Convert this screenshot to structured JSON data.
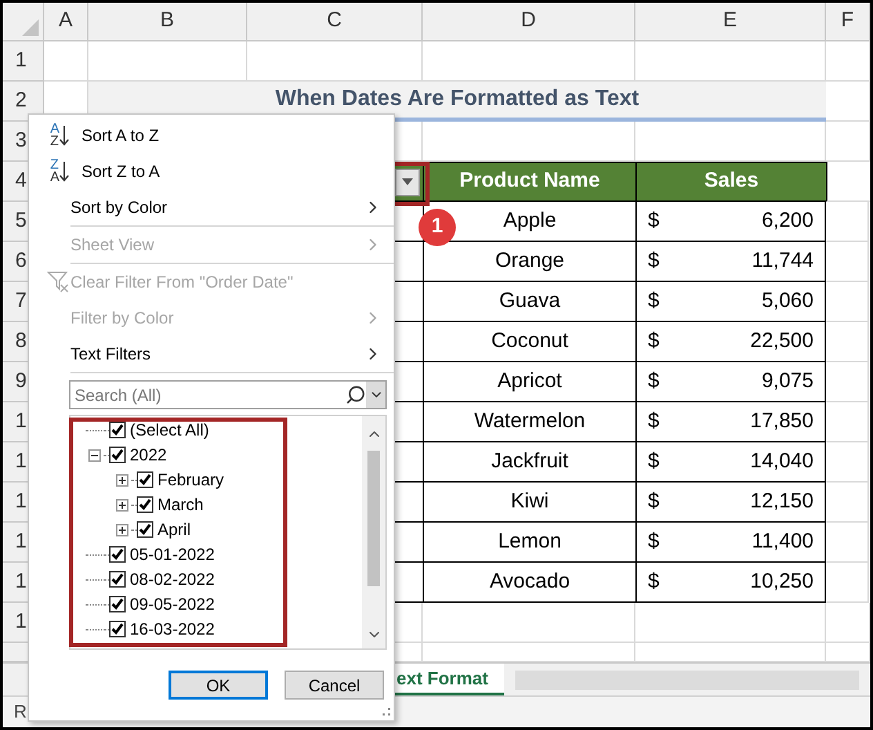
{
  "columns": [
    "A",
    "B",
    "C",
    "D",
    "E",
    "F"
  ],
  "row_numbers": [
    "1",
    "2",
    "3",
    "4",
    "5",
    "6",
    "7",
    "8",
    "9",
    "1",
    "1",
    "1",
    "1",
    "1",
    "1"
  ],
  "title": "When Dates Are Formatted as Text",
  "table": {
    "columns": [
      "Product Name",
      "Sales"
    ],
    "rows": [
      {
        "product": "Apple",
        "currency": "$",
        "sales": "6,200"
      },
      {
        "product": "Orange",
        "currency": "$",
        "sales": "11,744"
      },
      {
        "product": "Guava",
        "currency": "$",
        "sales": "5,060"
      },
      {
        "product": "Coconut",
        "currency": "$",
        "sales": "22,500"
      },
      {
        "product": "Apricot",
        "currency": "$",
        "sales": "9,075"
      },
      {
        "product": "Watermelon",
        "currency": "$",
        "sales": "17,850"
      },
      {
        "product": "Jackfruit",
        "currency": "$",
        "sales": "14,040"
      },
      {
        "product": "Kiwi",
        "currency": "$",
        "sales": "12,150"
      },
      {
        "product": "Lemon",
        "currency": "$",
        "sales": "11,400"
      },
      {
        "product": "Avocado",
        "currency": "$",
        "sales": "10,250"
      }
    ]
  },
  "step_badge": "1",
  "filter_menu": {
    "items": [
      {
        "kind": "sort",
        "label": "Sort A to Z",
        "icon_top": "A",
        "icon_bottom": "Z",
        "disabled": false,
        "submenu": false,
        "separator_after": false
      },
      {
        "kind": "sort",
        "label": "Sort Z to A",
        "icon_top": "Z",
        "icon_bottom": "A",
        "disabled": false,
        "submenu": false,
        "separator_after": false
      },
      {
        "kind": "plain",
        "label": "Sort by Color",
        "disabled": false,
        "submenu": true,
        "separator_after": true
      },
      {
        "kind": "plain",
        "label": "Sheet View",
        "disabled": true,
        "submenu": true,
        "separator_after": true
      },
      {
        "kind": "clear",
        "label": "Clear Filter From \"Order Date\"",
        "disabled": true,
        "submenu": false,
        "separator_after": false
      },
      {
        "kind": "plain",
        "label": "Filter by Color",
        "disabled": true,
        "submenu": true,
        "separator_after": false
      },
      {
        "kind": "plain",
        "label": "Text Filters",
        "disabled": false,
        "submenu": true,
        "separator_after": true
      }
    ],
    "search": {
      "placeholder": "Search (All)"
    },
    "tree": [
      {
        "label": "(Select All)",
        "checked": true
      },
      {
        "label": "2022",
        "checked": true,
        "expanded": true,
        "children": [
          {
            "label": "February",
            "checked": true,
            "expanded": false
          },
          {
            "label": "March",
            "checked": true,
            "expanded": false
          },
          {
            "label": "April",
            "checked": true,
            "expanded": false
          }
        ]
      },
      {
        "label": "05-01-2022",
        "checked": true
      },
      {
        "label": "08-02-2022",
        "checked": true
      },
      {
        "label": "09-05-2022",
        "checked": true
      },
      {
        "label": "16-03-2022",
        "checked": true
      }
    ],
    "buttons": [
      {
        "label": "OK",
        "default": true
      },
      {
        "label": "Cancel",
        "default": false
      }
    ]
  },
  "sheet_tab": {
    "label": "ext Format",
    "selected": true
  },
  "status_bar": "R"
}
